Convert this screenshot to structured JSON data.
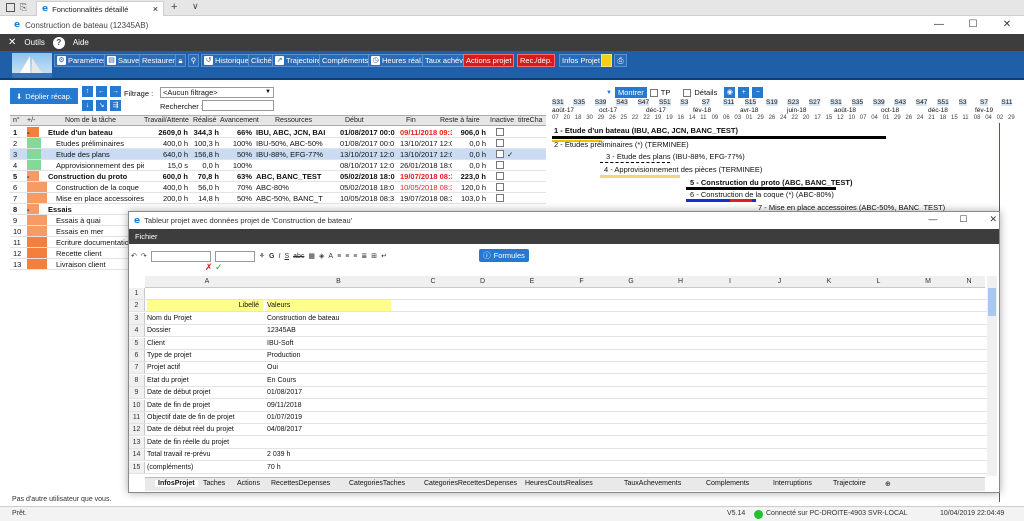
{
  "browser": {
    "tab_title": "Fonctionnalités détaillé",
    "close": "×",
    "new_tab": "+"
  },
  "app": {
    "title": "Construction de bateau (12345AB)",
    "menu": [
      "Outils",
      "Aide"
    ],
    "ribbon": [
      "Paramètres",
      "Sauver",
      "Restaurer",
      "Historique",
      "Cliché",
      "Trajectoire",
      "Compléments",
      "Heures réal.",
      "Taux achév.",
      "Actions projet",
      "Rec./dép.",
      "Infos Projet"
    ]
  },
  "toolbar": {
    "deplier": "Déplier récap.",
    "filtrage_label": "Filtrage :",
    "filtrage_value": "<Aucun filtrage>",
    "rechercher_label": "Rechercher :"
  },
  "grid": {
    "headers": [
      "n°",
      "+/-",
      "Nom de la tâche",
      "Travail/Attente",
      "Réalisé",
      "Avancement",
      "Ressources",
      "Début",
      "Fin",
      "Reste à faire",
      "Inactive",
      "titreCha"
    ],
    "rows": [
      {
        "n": "1",
        "t": "-",
        "name": "Etude d'un bateau",
        "travail": "2609,0 h",
        "realise": "344,3 h",
        "av": "66%",
        "res": "IBU, ABC, JCN, BAI",
        "debut": "01/08/2017 00:0",
        "fin": "09/11/2018 09:3",
        "reste": "906,0 h",
        "check": "",
        "bold": true,
        "lvl": "lvl0"
      },
      {
        "n": "2",
        "t": "",
        "name": "Etudes préliminaires",
        "travail": "400,0 h",
        "realise": "100,3 h",
        "av": "100%",
        "res": "IBU-50%, ABC-50%",
        "debut": "01/08/2017 00:0",
        "fin": "13/10/2017 12:0",
        "reste": "0,0 h",
        "check": "",
        "bold": false,
        "lvl": "lvl2"
      },
      {
        "n": "3",
        "t": "",
        "name": "Etude des plans",
        "travail": "640,0 h",
        "realise": "156,8 h",
        "av": "50%",
        "res": "IBU-88%, EFG-77%",
        "debut": "13/10/2017 12:0",
        "fin": "13/10/2017 12:0",
        "reste": "0,0 h",
        "check": "✓",
        "bold": false,
        "lvl": "lvl2"
      },
      {
        "n": "4",
        "t": "",
        "name": "Approvisionnement des pièces",
        "travail": "15,0 s",
        "realise": "0,0 h",
        "av": "100%",
        "res": "",
        "debut": "08/10/2017 12:0",
        "fin": "26/01/2018 18:0",
        "reste": "0,0 h",
        "check": "",
        "bold": false,
        "lvl": "lvl2"
      },
      {
        "n": "5",
        "t": "-",
        "name": "Construction du proto",
        "travail": "600,0 h",
        "realise": "70,8 h",
        "av": "63%",
        "res": "ABC, BANC_TEST",
        "debut": "05/02/2018 18:0",
        "fin": "19/07/2018 08:3",
        "reste": "223,0 h",
        "check": "",
        "bold": true,
        "lvl": "lvl1"
      },
      {
        "n": "6",
        "t": "",
        "name": "Construction de la coque",
        "travail": "400,0 h",
        "realise": "56,0 h",
        "av": "70%",
        "res": "ABC-80%",
        "debut": "05/02/2018 18:0",
        "fin": "10/05/2018 08:3",
        "reste": "120,0 h",
        "check": "",
        "bold": false,
        "lvl": "lvl1"
      },
      {
        "n": "7",
        "t": "",
        "name": "Mise en place accessoires",
        "travail": "200,0 h",
        "realise": "14,8 h",
        "av": "50%",
        "res": "ABC-50%, BANC_T",
        "debut": "10/05/2018 08:3",
        "fin": "19/07/2018 08:3",
        "reste": "103,0 h",
        "check": "",
        "bold": false,
        "lvl": "lvl1"
      },
      {
        "n": "8",
        "t": "-",
        "name": "Essais",
        "travail": "",
        "realise": "",
        "av": "",
        "res": "",
        "debut": "",
        "fin": "",
        "reste": "",
        "check": "",
        "bold": true,
        "lvl": "lvl1"
      },
      {
        "n": "9",
        "t": "",
        "name": "Essais à quai",
        "travail": "",
        "realise": "",
        "av": "",
        "res": "",
        "debut": "",
        "fin": "",
        "reste": "",
        "check": "",
        "bold": false,
        "lvl": "lvl1"
      },
      {
        "n": "10",
        "t": "",
        "name": "Essais en mer",
        "travail": "",
        "realise": "",
        "av": "",
        "res": "",
        "debut": "",
        "fin": "",
        "reste": "",
        "check": "",
        "bold": false,
        "lvl": "lvl1"
      },
      {
        "n": "11",
        "t": "",
        "name": "Ecriture documentation",
        "travail": "",
        "realise": "",
        "av": "",
        "res": "",
        "debut": "",
        "fin": "",
        "reste": "",
        "check": "",
        "bold": false,
        "lvl": "lvl0"
      },
      {
        "n": "12",
        "t": "",
        "name": "Recette client",
        "travail": "",
        "realise": "",
        "av": "",
        "res": "",
        "debut": "",
        "fin": "",
        "reste": "",
        "check": "",
        "bold": false,
        "lvl": "lvl0"
      },
      {
        "n": "13",
        "t": "",
        "name": "Livraison client",
        "travail": "",
        "realise": "",
        "av": "",
        "res": "",
        "debut": "",
        "fin": "",
        "reste": "",
        "check": "",
        "bold": false,
        "lvl": "lvl0"
      }
    ]
  },
  "gantt": {
    "montrer": "Montrer",
    "tp": "TP",
    "details": "Détails",
    "weeks": [
      "S31",
      "S35",
      "S39",
      "S43",
      "S47",
      "S51",
      "S3",
      "S7",
      "S11",
      "S15",
      "S19",
      "S23",
      "S27",
      "S31",
      "S35",
      "S39",
      "S43",
      "S47",
      "S51",
      "S3",
      "S7",
      "S11"
    ],
    "months": [
      "août-17",
      "oct-17",
      "déc-17",
      "fév-18",
      "avr-18",
      "juin-18",
      "août-18",
      "oct-18",
      "déc-18",
      "fév-19"
    ],
    "days": [
      "07",
      "20",
      "18",
      "30",
      "29",
      "26",
      "25",
      "22",
      "22",
      "19",
      "19",
      "16",
      "14",
      "11",
      "09",
      "06",
      "03",
      "01",
      "29",
      "26",
      "24",
      "22",
      "20",
      "17",
      "15",
      "12",
      "10",
      "07",
      "04",
      "01",
      "29",
      "26",
      "24",
      "21",
      "18",
      "15",
      "11",
      "08",
      "04",
      "02",
      "29"
    ],
    "labels": [
      "1 - Etude d'un bateau (IBU, ABC, JCN, BANC_TEST)",
      "2 - Etudes préliminaires (*) (TERMINEE)",
      "3 - Etude des plans (IBU-88%, EFG-77%)",
      "4 - Approvisionnement des pièces (TERMINEE)",
      "5 - Construction du proto (ABC, BANC_TEST)",
      "6 - Construction de la coque (*) (ABC-80%)",
      "7 - Mise en place accessoires (ABC-50%, BANC_TEST)"
    ]
  },
  "dialog": {
    "title": "Tableur projet avec données projet de 'Construction de bateau'",
    "menu": "Fichier",
    "formules": "Formules",
    "columns": [
      "A",
      "B",
      "C",
      "D",
      "E",
      "F",
      "G",
      "H",
      "I",
      "J",
      "K",
      "L",
      "M",
      "N"
    ],
    "rows": [
      {
        "n": "1",
        "a": "",
        "b": ""
      },
      {
        "n": "2",
        "a": "Libellé",
        "b": "Valeurs"
      },
      {
        "n": "3",
        "a": "Nom du Projet",
        "b": "Construction de bateau"
      },
      {
        "n": "4",
        "a": "Dossier",
        "b": "12345AB"
      },
      {
        "n": "5",
        "a": "Client",
        "b": "IBU-Soft"
      },
      {
        "n": "6",
        "a": "Type de projet",
        "b": "Production"
      },
      {
        "n": "7",
        "a": "Projet actif",
        "b": "Oui"
      },
      {
        "n": "8",
        "a": "Etat du projet",
        "b": "En Cours"
      },
      {
        "n": "9",
        "a": "Date de début projet",
        "b": "01/08/2017"
      },
      {
        "n": "10",
        "a": "Date de fin de projet",
        "b": "09/11/2018"
      },
      {
        "n": "11",
        "a": "Objectif date de fin de projet",
        "b": "01/07/2019"
      },
      {
        "n": "12",
        "a": "Date de début réel du projet",
        "b": "04/08/2017"
      },
      {
        "n": "13",
        "a": "Date de fin réelle du projet",
        "b": ""
      },
      {
        "n": "14",
        "a": "Total travail re-prévu",
        "b": "2 039 h"
      },
      {
        "n": "15",
        "a": "(compléments)",
        "b": "70 h"
      }
    ],
    "sheet_tabs": [
      "InfosProjet",
      "Taches",
      "Actions",
      "RecettesDepenses",
      "CategoriesTaches",
      "CategoriesRecettesDepenses",
      "HeuresCoutsRealises",
      "TauxAchevements",
      "Complements",
      "Interruptions",
      "Trajectoire"
    ]
  },
  "status": {
    "message": "Pas d'autre utilisateur que vous.",
    "ready": "Prêt.",
    "version": "V5.14",
    "connection": "Connecté sur PC-DROITE-4903 SVR-LOCAL",
    "datetime": "10/04/2019   22:04:49"
  }
}
